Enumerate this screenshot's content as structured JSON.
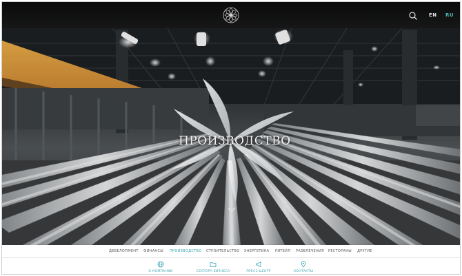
{
  "header": {
    "lang_en": "EN",
    "lang_ru": "RU",
    "active_lang": "RU",
    "logo_icon": "flower-logo-icon",
    "search_icon": "search-icon"
  },
  "hero": {
    "title": "ПРОИЗВОДСТВО",
    "scroll_icon": "chevron-down-icon"
  },
  "categories": [
    {
      "label": "ДЕВЕЛОПМЕНТ",
      "active": false
    },
    {
      "label": "ФИНАНСЫ",
      "active": false
    },
    {
      "label": "ПРОИЗВОДСТВО",
      "active": true
    },
    {
      "label": "СТРОИТЕЛЬСТВО",
      "active": false
    },
    {
      "label": "ЭНЕРГЕТИКА",
      "active": false
    },
    {
      "label": "РИТЕЙЛ",
      "active": false
    },
    {
      "label": "РАЗВЛЕЧЕНИЯ",
      "active": false
    },
    {
      "label": "РЕСТОРАНЫ",
      "active": false
    },
    {
      "label": "ДРУГИЕ",
      "active": false
    }
  ],
  "bottom_links": [
    {
      "label": "О КОМПАНИИ",
      "icon": "globe-icon"
    },
    {
      "label": "СЕКТОРА БИЗНЕСА",
      "icon": "folder-icon"
    },
    {
      "label": "ПРЕСС-ЦЕНТР",
      "icon": "megaphone-icon"
    },
    {
      "label": "КОНТАКТЫ",
      "icon": "location-pin-icon"
    }
  ],
  "colors": {
    "accent": "#3aa6b2",
    "lang_active": "#4fb3bd",
    "nav_text": "#5b5b5b"
  }
}
